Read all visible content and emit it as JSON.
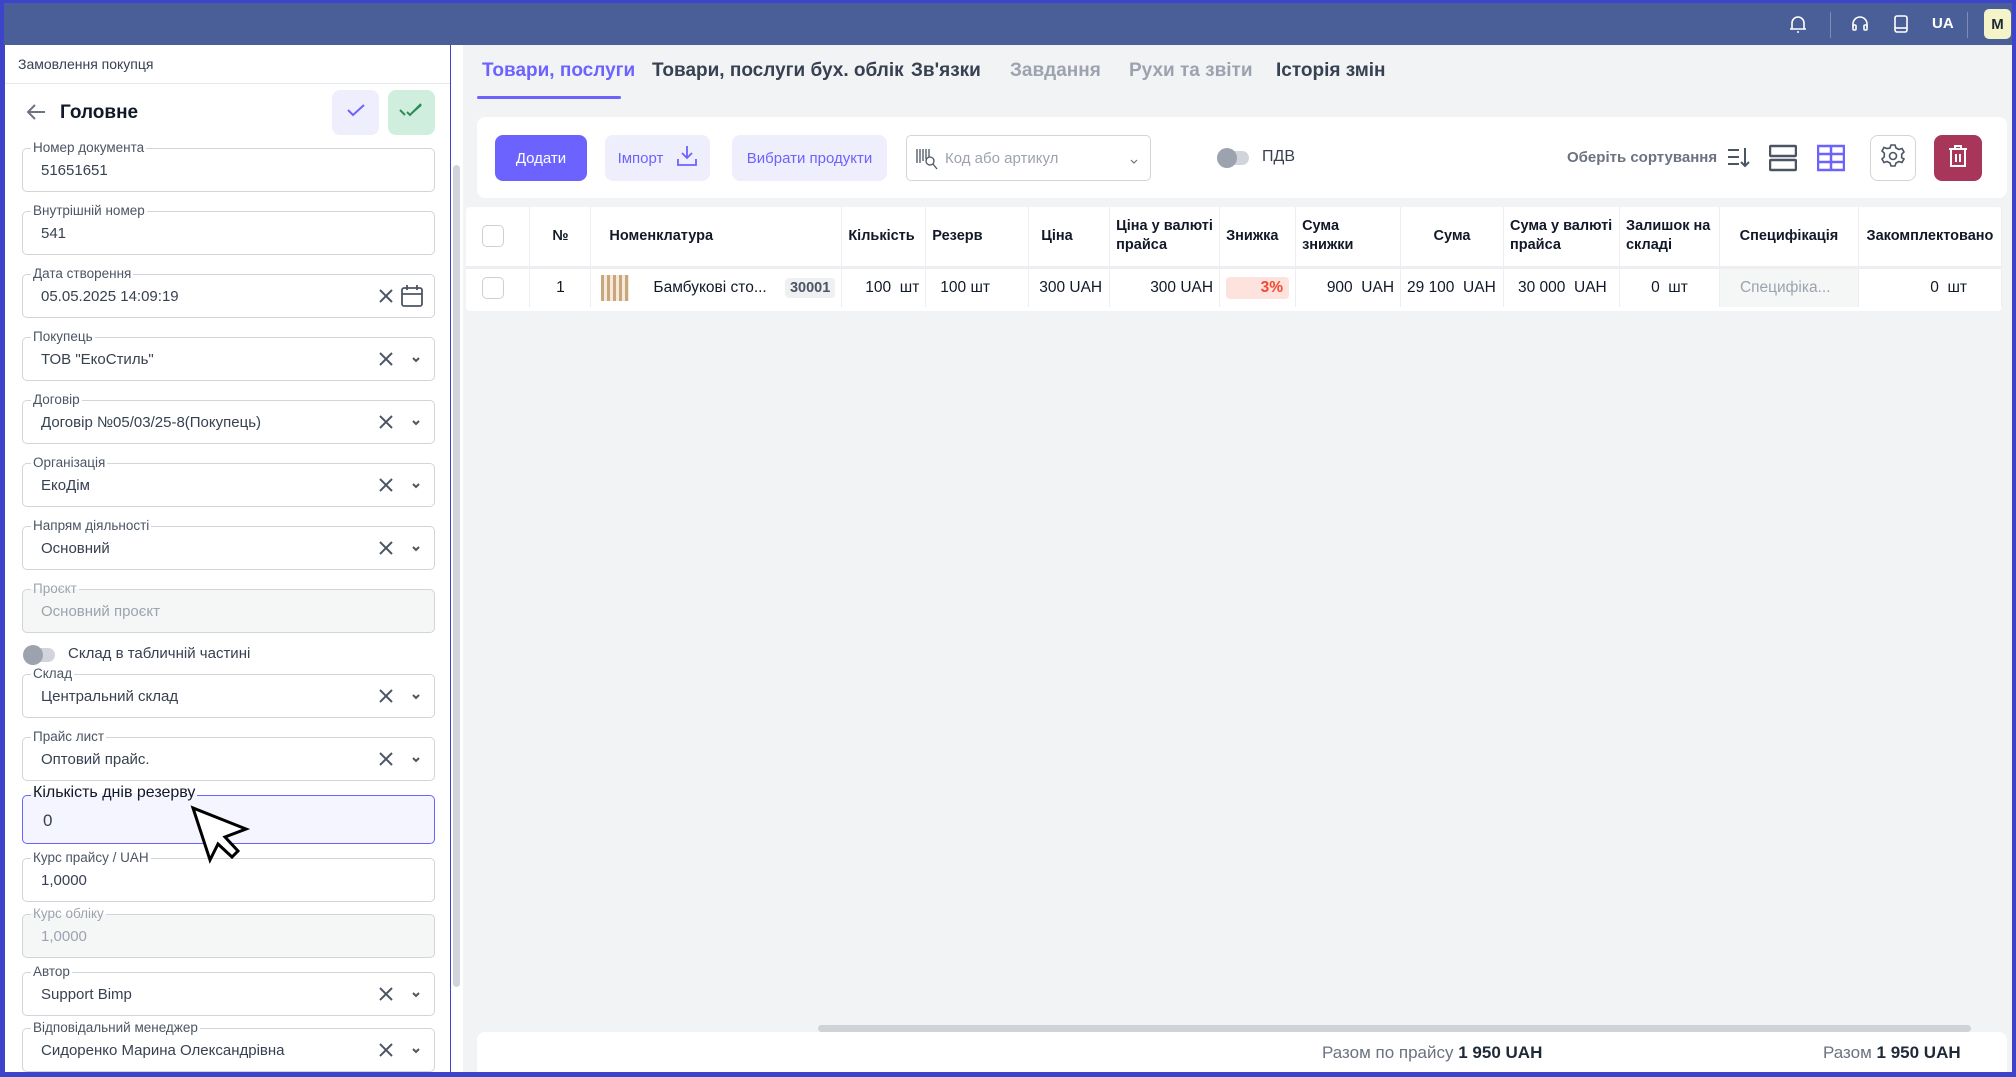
{
  "topbar": {
    "language": "UA",
    "avatar_initial": "M",
    "icons": [
      "bell-icon",
      "headset-icon",
      "book-icon"
    ]
  },
  "left": {
    "breadcrumb": "Замовлення покупця",
    "title": "Головне",
    "fields": [
      {
        "label": "Номер документа",
        "value": "51651651"
      },
      {
        "label": "Внутрішній номер",
        "value": "541"
      },
      {
        "label": "Дата створення",
        "value": "05.05.2025 14:09:19"
      },
      {
        "label": "Покупець",
        "value": "ТОВ \"ЕкоСтиль\""
      },
      {
        "label": "Договір",
        "value": "Договір №05/03/25-8(Покупець)"
      },
      {
        "label": "Організація",
        "value": "ЕкоДім"
      },
      {
        "label": "Напрям діяльності",
        "value": "Основний"
      },
      {
        "label": "Проєкт",
        "value": "Основний проєкт"
      },
      {
        "label": "Склад",
        "value": "Центральний склад"
      },
      {
        "label": "Прайс лист",
        "value": "Оптовий прайс."
      },
      {
        "label": "Кількість днів резерву",
        "value": "0"
      },
      {
        "label": "Курс прайсу / UAH",
        "value": "1,0000"
      },
      {
        "label": "Курс обліку",
        "value": "1,0000"
      },
      {
        "label": "Автор",
        "value": "Support Bimp"
      },
      {
        "label": "Відповідальний менеджер",
        "value": "Сидоренко Марина Олександрівна"
      }
    ],
    "toggle_label": "Склад в табличній частині",
    "toggle_on": false
  },
  "tabs": [
    {
      "label": "Товари, послуги",
      "state": "active"
    },
    {
      "label": "Товари, послуги бух. облік",
      "state": "normal"
    },
    {
      "label": "Зв'язки",
      "state": "normal"
    },
    {
      "label": "Завдання",
      "state": "disabled"
    },
    {
      "label": "Рухи та звіти",
      "state": "disabled"
    },
    {
      "label": "Історія змін",
      "state": "normal"
    }
  ],
  "toolbar": {
    "add": "Додати",
    "import": "Імпорт",
    "select_products": "Вибрати продукти",
    "search_placeholder": "Код або артикул",
    "vat_label": "ПДВ",
    "sort_label": "Оберіть сортування"
  },
  "table": {
    "headers": [
      "№",
      "Номенклатура",
      "Кількість",
      "Резерв",
      "Ціна",
      "Ціна у валюті прайса",
      "Знижка",
      "Сума знижки",
      "Сума",
      "Сума у валюті прайса",
      "Залишок на складі",
      "Специфікація",
      "Закомплектовано"
    ],
    "rows": [
      {
        "num": "1",
        "name": "Бамбукові сто...",
        "code": "30001",
        "qty": "100  шт",
        "reserve": "100 шт",
        "price": "300 UAH",
        "price_list": "300 UAH",
        "discount": "3%",
        "discount_sum": "900  UAH",
        "sum": "29 100  UAH",
        "sum_list": "30 000  UAH",
        "stock": "0  шт",
        "spec": "Специфіка...",
        "completed": "0  шт"
      }
    ]
  },
  "footer": {
    "price_total_label": "Разом по прайсу",
    "price_total": "1 950 UAH",
    "total_label": "Разом",
    "total": "1 950 UAH"
  },
  "colors": {
    "accent": "#6c63ff",
    "header": "#4a5f98",
    "frame": "#3d44c9",
    "delete": "#a8355a"
  }
}
